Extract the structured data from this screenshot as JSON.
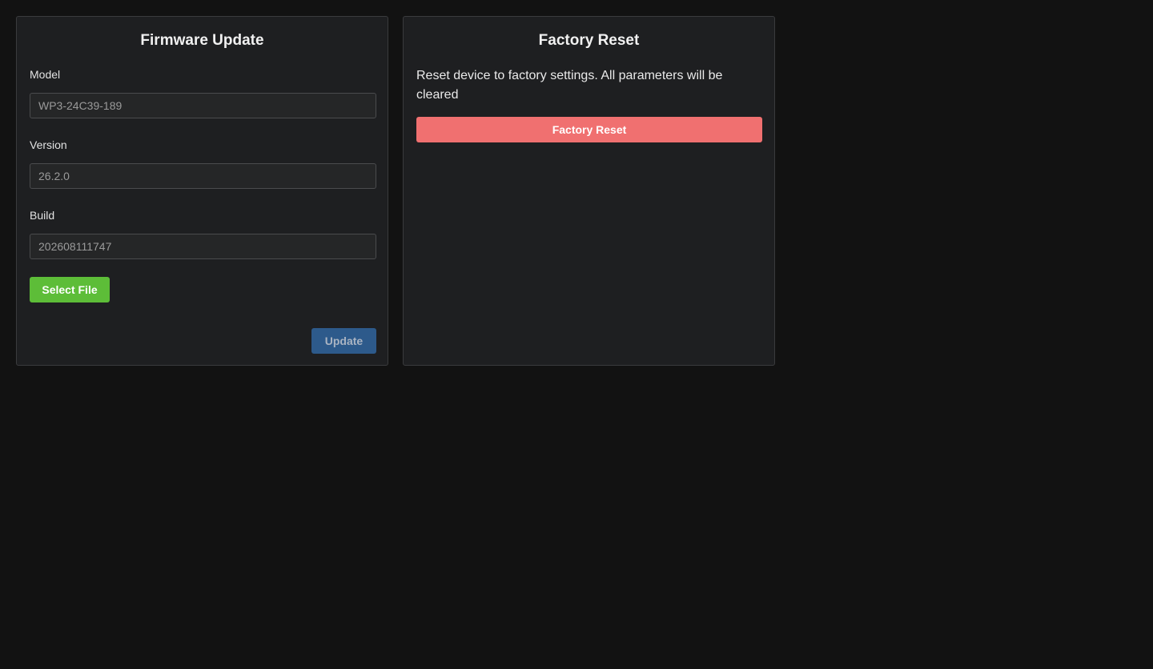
{
  "firmware": {
    "title": "Firmware Update",
    "fields": [
      {
        "label": "Model",
        "value": "WP3-24C39-189"
      },
      {
        "label": "Version",
        "value": "26.2.0"
      },
      {
        "label": "Build",
        "value": "202608111747"
      }
    ],
    "select_file_label": "Select File",
    "update_label": "Update",
    "update_enabled": false
  },
  "factory_reset": {
    "title": "Factory Reset",
    "description": "Reset device to factory settings. All parameters will be cleared",
    "button_label": "Factory Reset"
  },
  "colors": {
    "background": "#121212",
    "panel": "#1e1f21",
    "select_file": "#5dbd38",
    "update": "#2d5a8b",
    "factory_reset": "#f07070"
  }
}
